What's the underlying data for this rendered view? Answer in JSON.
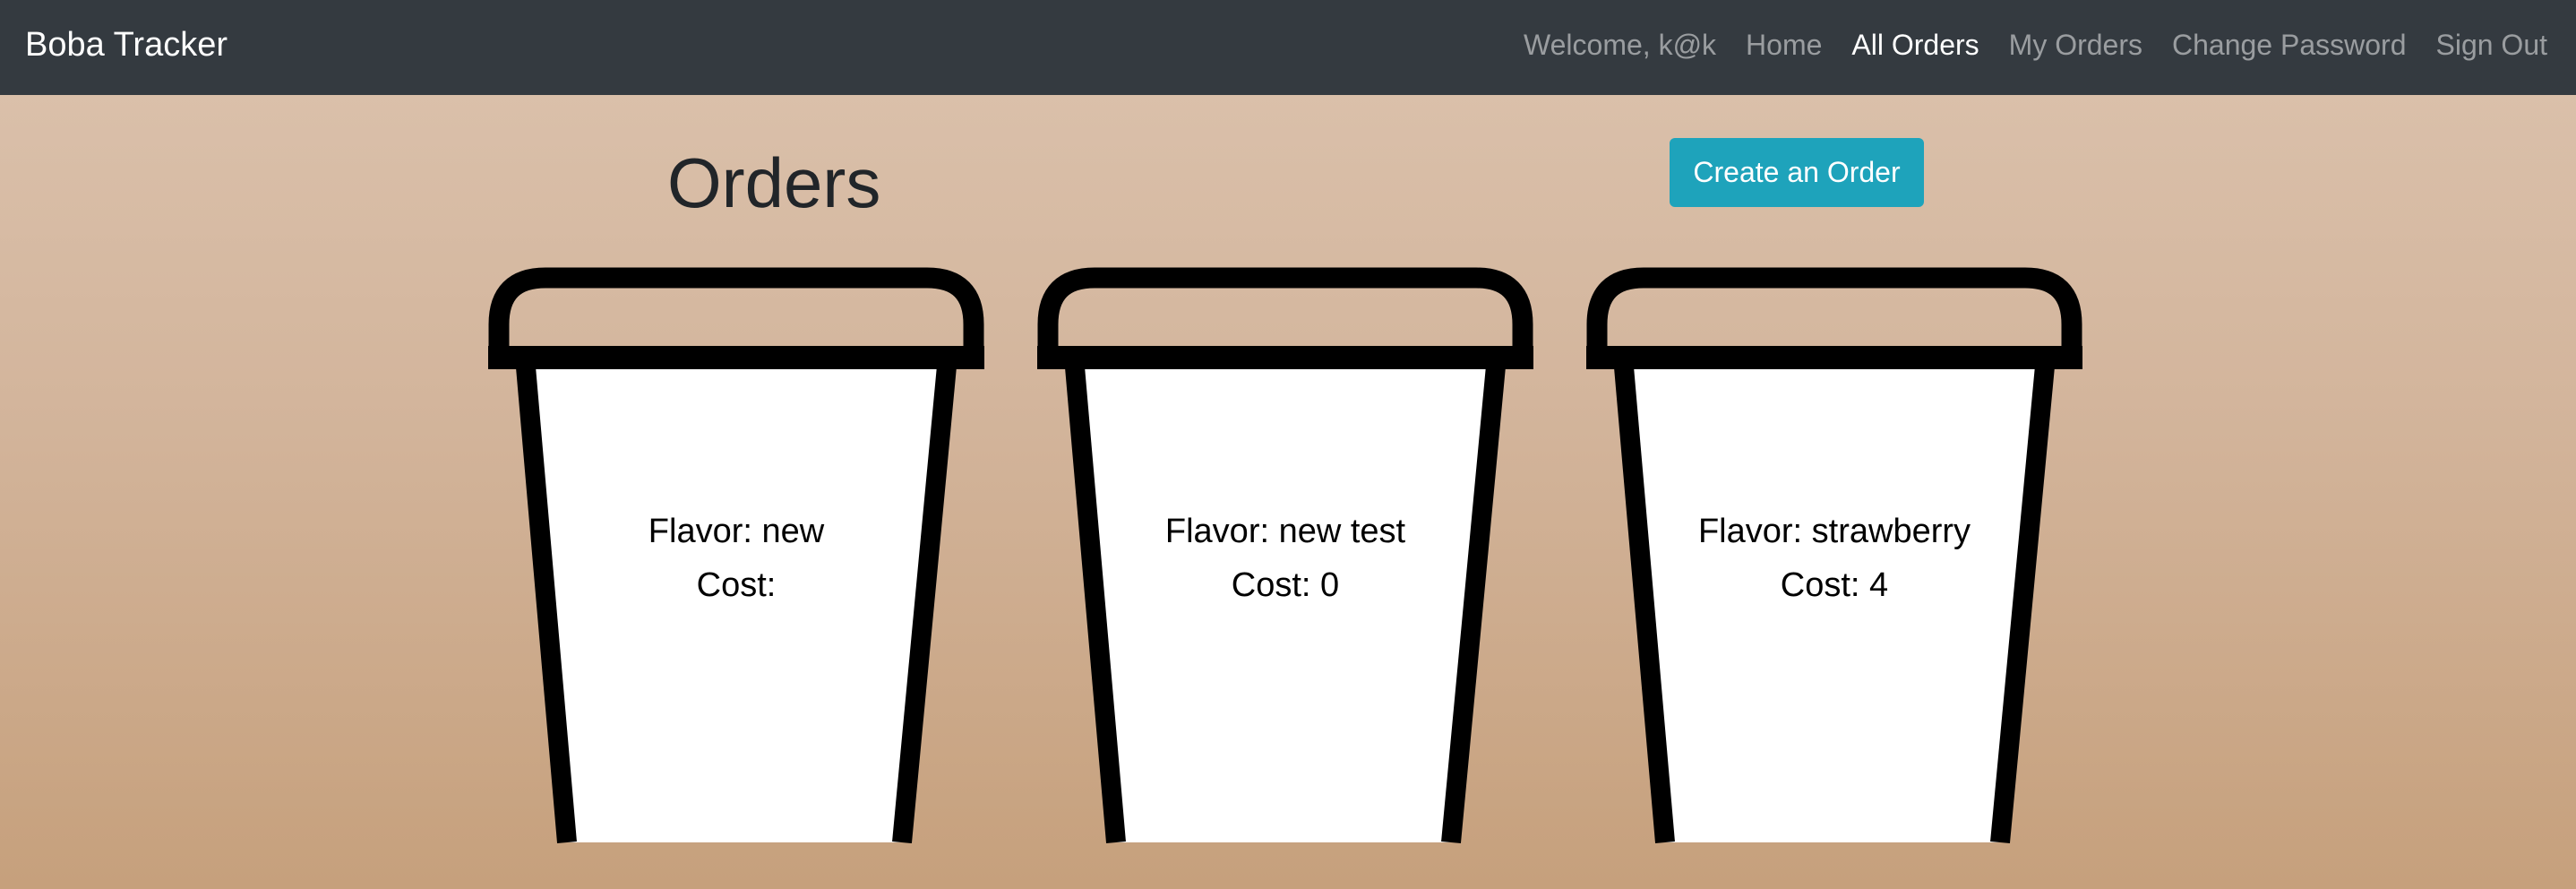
{
  "navbar": {
    "brand": "Boba Tracker",
    "welcome": "Welcome, k@k",
    "links": [
      {
        "label": "Home"
      },
      {
        "label": "All Orders"
      },
      {
        "label": "My Orders"
      },
      {
        "label": "Change Password"
      },
      {
        "label": "Sign Out"
      }
    ]
  },
  "page": {
    "title": "Orders",
    "create_button": "Create an Order"
  },
  "orders": [
    {
      "flavor": "Flavor: new",
      "cost": "Cost:"
    },
    {
      "flavor": "Flavor: new test",
      "cost": "Cost: 0"
    },
    {
      "flavor": "Flavor: strawberry",
      "cost": "Cost: 4"
    }
  ]
}
